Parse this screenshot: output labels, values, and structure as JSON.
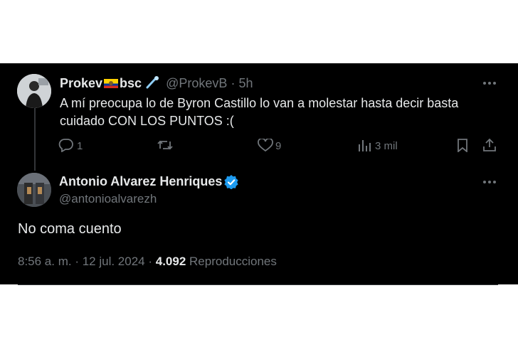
{
  "reply_tweet": {
    "display_name": "Prokev",
    "name_suffix": "bsc",
    "handle": "@ProkevB",
    "separator": "·",
    "time": "5h",
    "text_line1": "A mí preocupa lo de Byron Castillo lo van a molestar hasta decir basta",
    "text_line2": "cuidado CON LOS PUNTOS :(",
    "reply_count": "1",
    "like_count": "9",
    "views": "3 mil"
  },
  "main_tweet": {
    "display_name": "Antonio Alvarez Henriques",
    "handle": "@antonioalvarezh",
    "text": "No coma cuento",
    "time": "8:56 a. m. · 12 jul. 2024 ·",
    "views_count": "4.092",
    "views_label": "Reproducciones"
  },
  "colors": {
    "background": "#000000",
    "text": "#e7e9ea",
    "muted": "#71767b",
    "verified": "#1d9bf0"
  },
  "icons": [
    "more-icon",
    "reply-icon",
    "retweet-icon",
    "like-icon",
    "views-icon",
    "bookmark-icon",
    "share-icon",
    "verified-icon",
    "flag-ecuador-icon",
    "comet-icon"
  ]
}
